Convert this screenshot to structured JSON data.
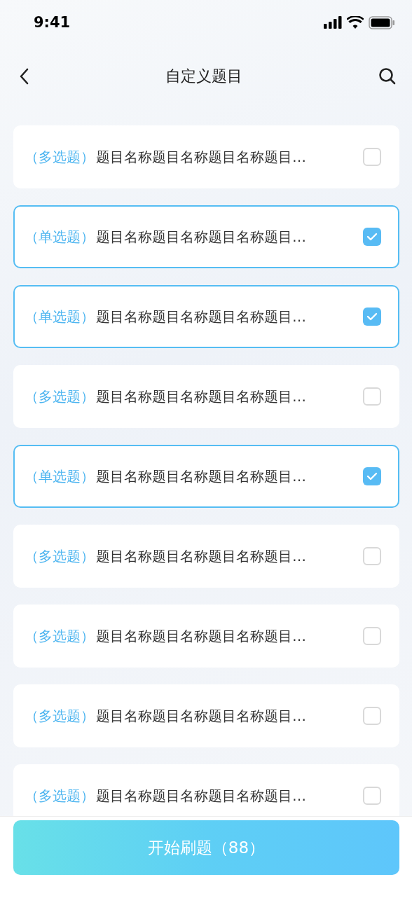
{
  "status_bar": {
    "time": "9:41"
  },
  "nav": {
    "title": "自定义题目"
  },
  "questions": [
    {
      "type": "（多选题）",
      "title": "题目名称题目名称题目名称题目…",
      "selected": false
    },
    {
      "type": "（单选题）",
      "title": "题目名称题目名称题目名称题目…",
      "selected": true
    },
    {
      "type": "（单选题）",
      "title": "题目名称题目名称题目名称题目…",
      "selected": true
    },
    {
      "type": "（多选题）",
      "title": "题目名称题目名称题目名称题目…",
      "selected": false
    },
    {
      "type": "（单选题）",
      "title": "题目名称题目名称题目名称题目…",
      "selected": true
    },
    {
      "type": "（多选题）",
      "title": "题目名称题目名称题目名称题目…",
      "selected": false
    },
    {
      "type": "（多选题）",
      "title": "题目名称题目名称题目名称题目…",
      "selected": false
    },
    {
      "type": "（多选题）",
      "title": "题目名称题目名称题目名称题目…",
      "selected": false
    },
    {
      "type": "（多选题）",
      "title": "题目名称题目名称题目名称题目…",
      "selected": false
    }
  ],
  "start_button": {
    "label": "开始刷题（88）"
  }
}
